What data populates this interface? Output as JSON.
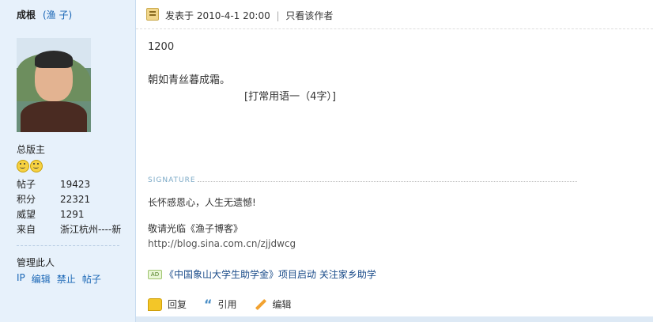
{
  "user": {
    "name": "成根",
    "nickname": "(渔 子)",
    "role": "总版主",
    "stats": [
      {
        "label": "帖子",
        "value": "19423"
      },
      {
        "label": "积分",
        "value": "22321"
      },
      {
        "label": "威望",
        "value": "1291"
      },
      {
        "label": "来自",
        "value": "浙江杭州----新"
      }
    ],
    "manage_title": "管理此人",
    "manage_links": [
      "IP",
      "编辑",
      "禁止",
      "帖子"
    ]
  },
  "post": {
    "posted_label": "发表于",
    "posted_time": "2010-4-1 20:00",
    "separator": "|",
    "only_author": "只看该作者",
    "line1": "1200",
    "line2": "朝如青丝暮成霜。",
    "line3": "[打常用语一（4字）]"
  },
  "signature": {
    "label": "SIGNATURE",
    "text1": "长怀感恩心，人生无遗憾!",
    "text2": "敬请光临《渔子博客》",
    "text3": "http://blog.sina.com.cn/zjjdwcg"
  },
  "ad": {
    "badge": "AD",
    "text": "《中国象山大学生助学金》项目启动 关注家乡助学"
  },
  "actions": {
    "reply": "回复",
    "quote": "引用",
    "edit": "编辑"
  }
}
